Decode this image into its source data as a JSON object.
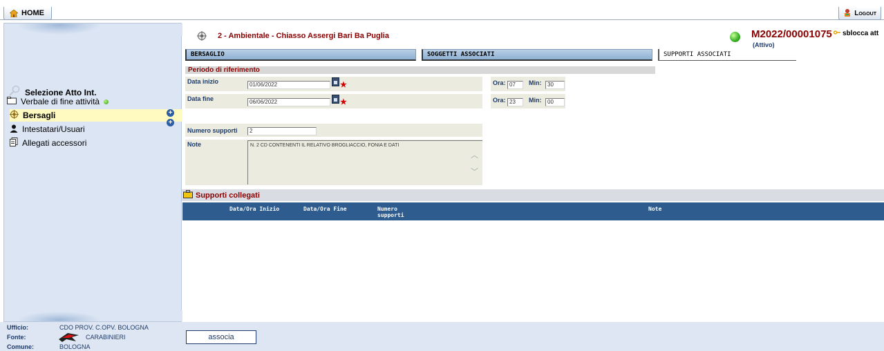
{
  "topbar": {
    "home_label": "HOME",
    "logout_label": "Logout"
  },
  "sidebar": {
    "title": "Selezione Atto Int.",
    "verbale": "Verbale di fine attività",
    "items": [
      {
        "label": "Bersagli"
      },
      {
        "label": "Intestatari/Usuari"
      },
      {
        "label": "Allegati accessori"
      }
    ],
    "footer": {
      "ufficio_label": "Ufficio:",
      "ufficio_value": "CDO PROV. C.OPV. BOLOGNA",
      "fonte_label": "Fonte:",
      "fonte_value": "CARABINIERI",
      "comune_label": "Comune:",
      "comune_value": "BOLOGNA"
    }
  },
  "header": {
    "title": "2 - Ambientale - Chiasso Assergi Bari Ba Puglia",
    "protocol": "M2022/00001075",
    "unlock": "sblocca att",
    "status": "(Attivo)"
  },
  "tabs": [
    {
      "label": "BERSAGLIO"
    },
    {
      "label": "SOGGETTI ASSOCIATI"
    },
    {
      "label": "SUPPORTI ASSOCIATI"
    }
  ],
  "form": {
    "section_title": "Periodo di riferimento",
    "data_inizio_label": "Data inizio",
    "data_inizio_value": "01/06/2022",
    "data_fine_label": "Data fine",
    "data_fine_value": "06/06/2022",
    "ora_label": "Ora:",
    "min_label": "Min:",
    "ora_inizio": "07",
    "min_inizio": "30",
    "ora_fine": "23",
    "min_fine": "00",
    "numero_supporti_label": "Numero supporti",
    "numero_supporti_value": "2",
    "note_label": "Note",
    "note_value": "N. 2 CD CONTENENTI IL RELATIVO BROGLIACCIO, FONIA E DATI"
  },
  "linked": {
    "title": "Supporti collegati",
    "columns": [
      "Data/Ora Inizio",
      "Data/Ora Fine",
      "Numero supporti",
      "Note"
    ]
  },
  "actions": {
    "associa_label": "associa"
  }
}
